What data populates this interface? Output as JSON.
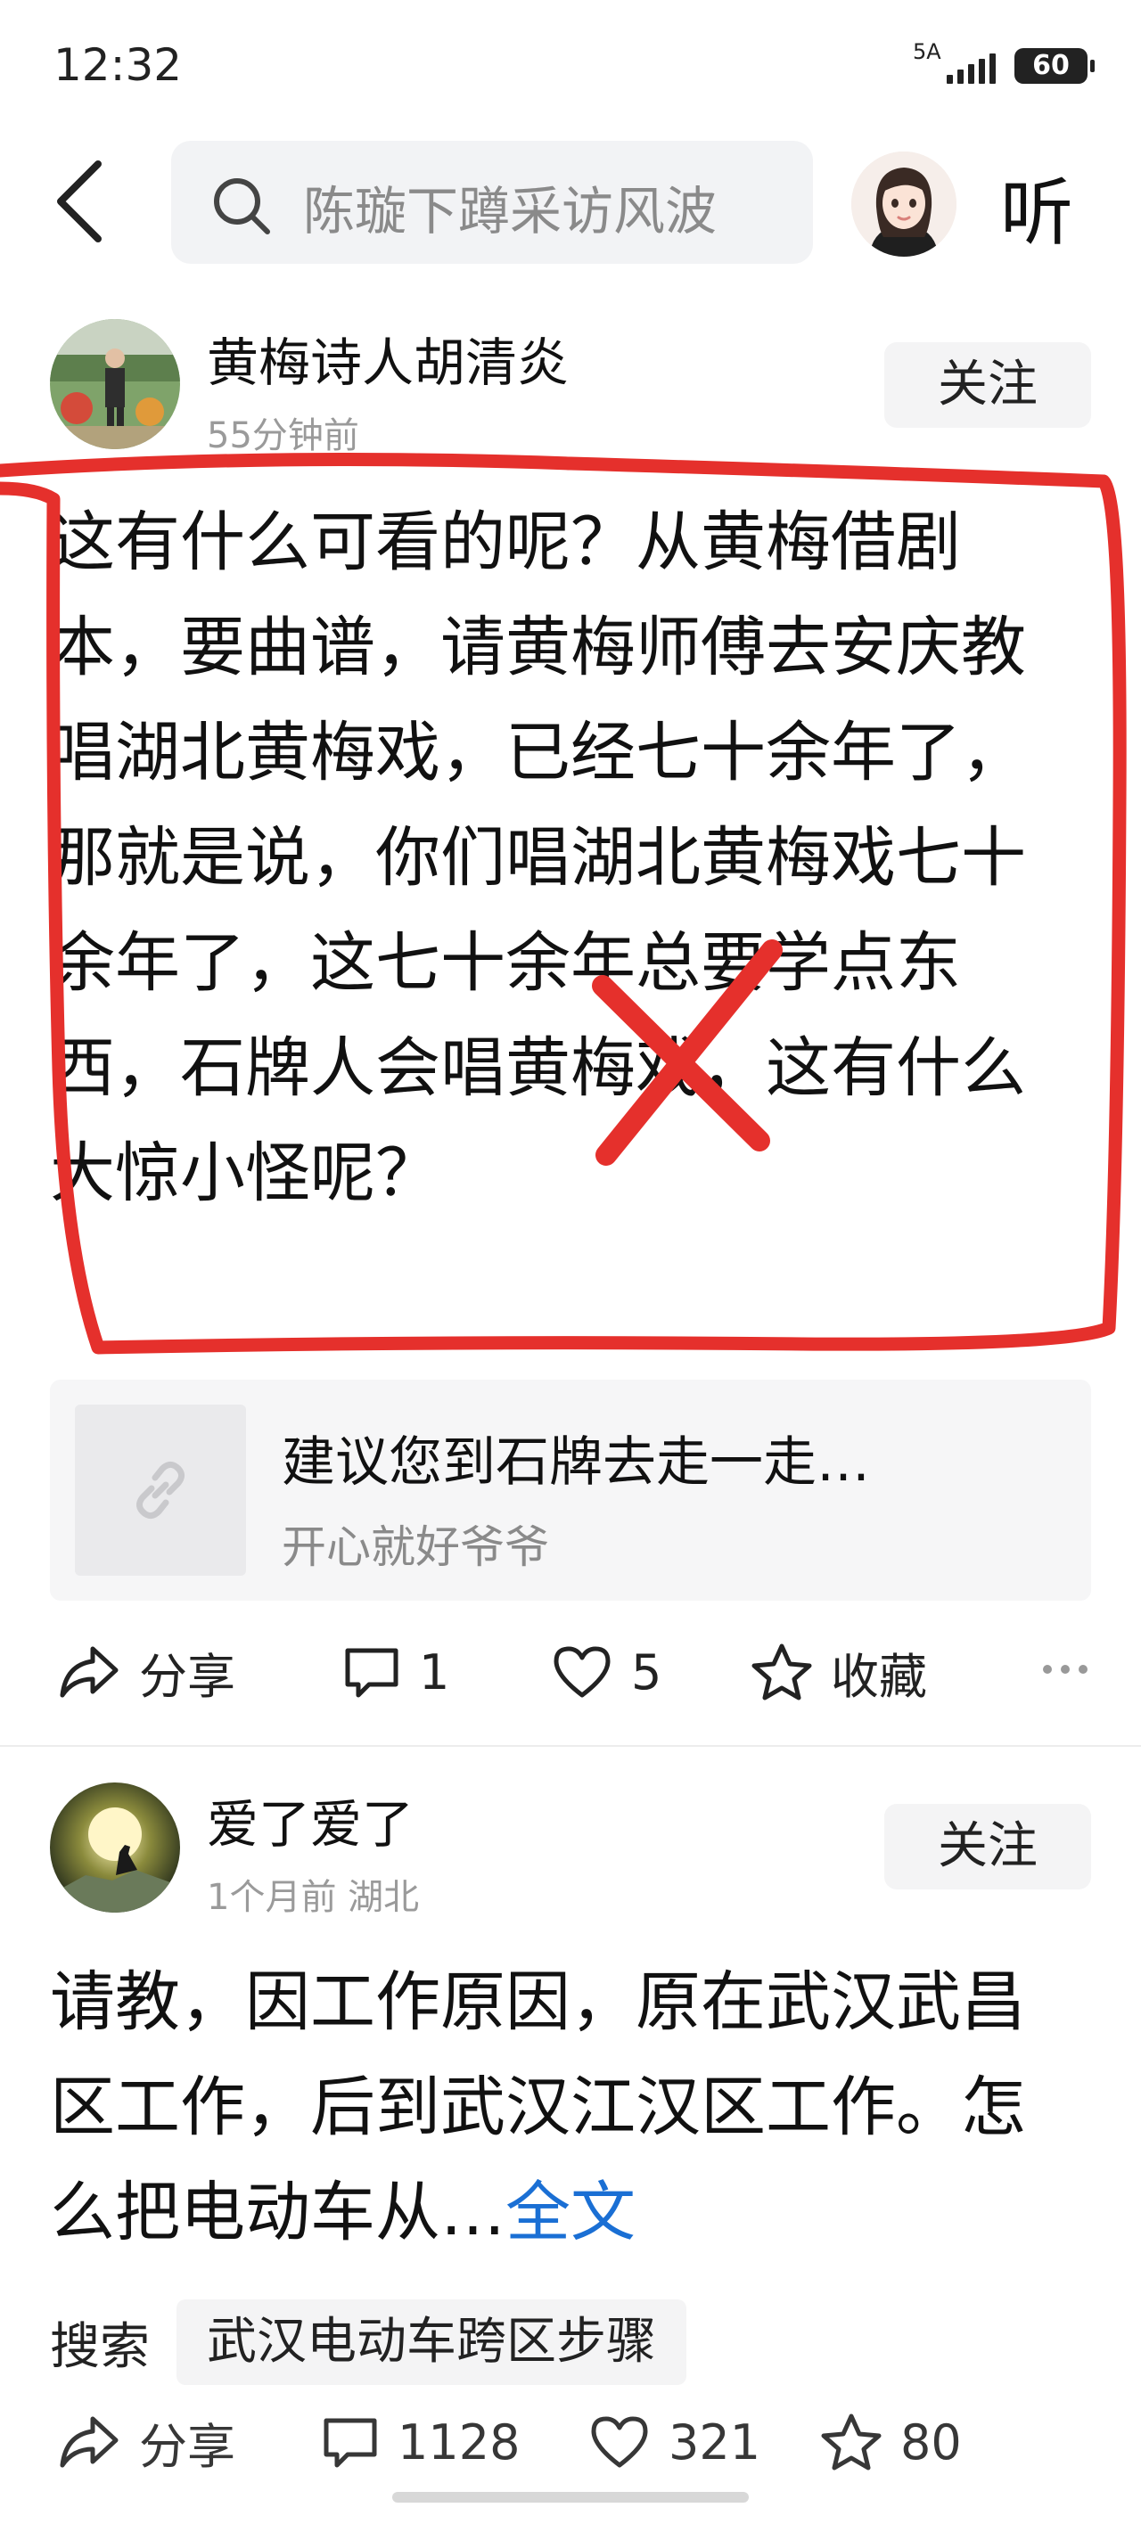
{
  "status": {
    "time": "12:32",
    "network": "5A",
    "battery": "60"
  },
  "search": {
    "placeholder": "陈璇下蹲采访风波"
  },
  "top": {
    "listen_label": "听"
  },
  "post1": {
    "author": "黄梅诗人胡清炎",
    "time": "55分钟前",
    "follow_label": "关注",
    "text": "这有什么可看的呢？从黄梅借剧本，要曲谱，请黄梅师傅去安庆教唱湖北黄梅戏，已经七十余年了，那就是说，你们唱湖北黄梅戏七十余年了，这七十余年总要学点东西，石牌人会唱黄梅戏，这有什么大惊小怪呢？",
    "link_card": {
      "title": "建议您到石牌去走一走…",
      "subtitle": "开心就好爷爷"
    },
    "actions": {
      "share": "分享",
      "comment_count": "1",
      "like_count": "5",
      "favorite": "收藏"
    }
  },
  "post2": {
    "author": "爱了爱了",
    "time": "1个月前 湖北",
    "follow_label": "关注",
    "text": "请教，因工作原因，原在武汉武昌区工作，后到武汉江汉区工作。怎么把电动车从…",
    "full_text_label": "全文",
    "search_label": "搜索",
    "search_chip": "武汉电动车跨区步骤",
    "actions": {
      "share": "分享",
      "comment_count": "1128",
      "like_count": "321",
      "favorite_count": "80"
    }
  },
  "colors": {
    "annotation_red": "#e5302c",
    "link_blue": "#1a6fd4"
  }
}
